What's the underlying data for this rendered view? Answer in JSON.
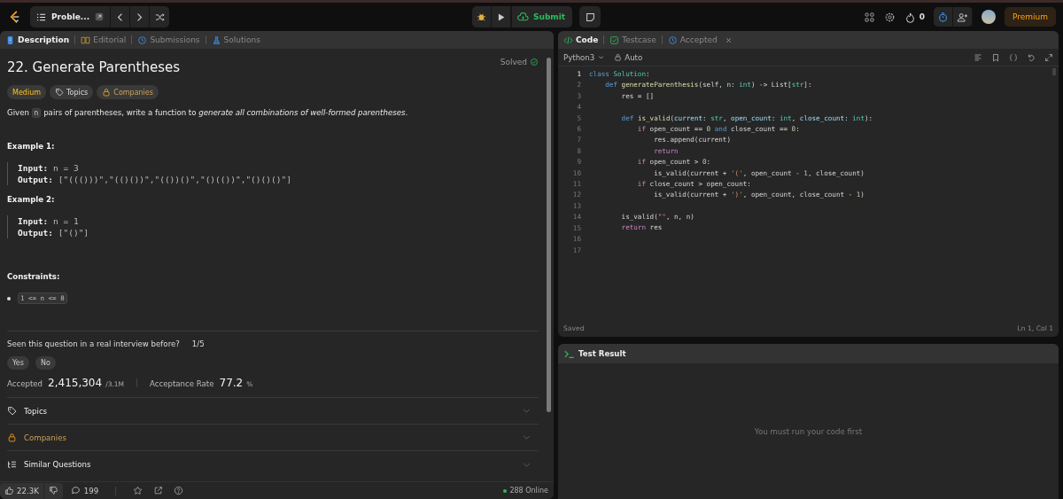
{
  "topbar": {
    "problem_list": "Proble...",
    "submit": "Submit",
    "streak": "0",
    "premium": "Premium"
  },
  "left_tabs": [
    {
      "label": "Description",
      "selected": true
    },
    {
      "label": "Editorial",
      "selected": false
    },
    {
      "label": "Submissions",
      "selected": false
    },
    {
      "label": "Solutions",
      "selected": false
    }
  ],
  "problem": {
    "title": "22. Generate Parentheses",
    "status": "Solved",
    "tags": [
      {
        "label": "Medium",
        "kind": "difficulty"
      },
      {
        "label": "Topics",
        "kind": "topics"
      },
      {
        "label": "Companies",
        "kind": "companies"
      }
    ],
    "description": [
      {
        "kind": "text",
        "text": "Given "
      },
      {
        "kind": "code",
        "text": "n"
      },
      {
        "kind": "text",
        "text": " pairs of parentheses, write a function to *generate all combinations of well-formed parentheses*."
      }
    ],
    "examples": [
      {
        "title": "Example 1:",
        "lines": [
          {
            "label": "Input:",
            "value": "n = 3"
          },
          {
            "label": "Output:",
            "value": "[\"((()))\",\"(()())\",\"(())()\",\"()(())\",\"()()()\"]"
          }
        ]
      },
      {
        "title": "Example 2:",
        "lines": [
          {
            "label": "Input:",
            "value": "n = 1"
          },
          {
            "label": "Output:",
            "value": "[\"()\"]"
          }
        ]
      }
    ],
    "constraints_title": "Constraints:",
    "constraints": [
      "1 <= n <= 8"
    ],
    "interview_question": "Seen this question in a real interview before?",
    "interview_count": "1/5",
    "answers": [
      "Yes",
      "No"
    ],
    "accepted_label": "Accepted",
    "accepted_value": "2,415,304",
    "accepted_total": "/3.1M",
    "rate_label": "Acceptance Rate",
    "rate_value": "77.2",
    "rate_unit": "%",
    "sections": [
      {
        "label": "Topics",
        "expanded": false
      },
      {
        "label": "Companies",
        "expanded": false
      },
      {
        "label": "Similar Questions",
        "expanded": false
      }
    ]
  },
  "bottom_bar": {
    "likes": "22.3K",
    "comments": "199",
    "online": "288 Online"
  },
  "right_tabs": [
    {
      "label": "Code",
      "selected": true,
      "closable": false
    },
    {
      "label": "Testcase",
      "selected": false,
      "closable": false
    },
    {
      "label": "Accepted",
      "selected": false,
      "closable": true
    }
  ],
  "editor": {
    "language": "Python3",
    "mode": "Auto",
    "status": "Saved",
    "cursor": "Ln 1, Col 1",
    "lines": [
      {
        "number": "1",
        "current": true,
        "code": [
          {
            "t": "class ",
            "kind": "kw"
          },
          {
            "t": "Solution",
            "kind": "type"
          },
          {
            "t": ":",
            "kind": "p"
          }
        ]
      },
      {
        "number": "2",
        "current": false,
        "code": [
          {
            "t": "    def ",
            "kind": "kw"
          },
          {
            "t": "generateParenthesis",
            "kind": "fn"
          },
          {
            "t": "(self, ",
            "kind": "p"
          },
          {
            "t": "n",
            "kind": "var"
          },
          {
            "t": ": ",
            "kind": "p"
          },
          {
            "t": "int",
            "kind": "type"
          },
          {
            "t": ") -> List[",
            "kind": "p"
          },
          {
            "t": "str",
            "kind": "type"
          },
          {
            "t": "]:",
            "kind": "p"
          }
        ]
      },
      {
        "number": "3",
        "current": false,
        "code": [
          {
            "t": "        res = []",
            "kind": "p"
          }
        ]
      },
      {
        "number": "4",
        "current": false
      },
      {
        "number": "5",
        "current": false,
        "code": [
          {
            "t": "        def ",
            "kind": "kw"
          },
          {
            "t": "is_valid",
            "kind": "fn"
          },
          {
            "t": "(",
            "kind": "p"
          },
          {
            "t": "current",
            "kind": "var"
          },
          {
            "t": ": ",
            "kind": "p"
          },
          {
            "t": "str",
            "kind": "type"
          },
          {
            "t": ", ",
            "kind": "p"
          },
          {
            "t": "open_count",
            "kind": "var"
          },
          {
            "t": ": ",
            "kind": "p"
          },
          {
            "t": "int",
            "kind": "type"
          },
          {
            "t": ", ",
            "kind": "p"
          },
          {
            "t": "close_count",
            "kind": "var"
          },
          {
            "t": ": ",
            "kind": "p"
          },
          {
            "t": "int",
            "kind": "type"
          },
          {
            "t": "):",
            "kind": "p"
          }
        ]
      },
      {
        "number": "6",
        "current": false,
        "code": [
          {
            "t": "            if ",
            "kind": "ctrl"
          },
          {
            "t": "open_count == ",
            "kind": "p"
          },
          {
            "t": "0",
            "kind": "num"
          },
          {
            "t": " and ",
            "kind": "kw"
          },
          {
            "t": "close_count == ",
            "kind": "p"
          },
          {
            "t": "0",
            "kind": "num"
          },
          {
            "t": ":",
            "kind": "p"
          }
        ]
      },
      {
        "number": "7",
        "current": false,
        "code": [
          {
            "t": "                res.append(current)",
            "kind": "p"
          }
        ]
      },
      {
        "number": "8",
        "current": false,
        "code": [
          {
            "t": "                return",
            "kind": "ctrl"
          }
        ]
      },
      {
        "number": "9",
        "current": false,
        "code": [
          {
            "t": "            if ",
            "kind": "ctrl"
          },
          {
            "t": "open_count > ",
            "kind": "p"
          },
          {
            "t": "0",
            "kind": "num"
          },
          {
            "t": ":",
            "kind": "p"
          }
        ]
      },
      {
        "number": "10",
        "current": false,
        "code": [
          {
            "t": "                is_valid(current + ",
            "kind": "p"
          },
          {
            "t": "'('",
            "kind": "str"
          },
          {
            "t": ", open_count - ",
            "kind": "p"
          },
          {
            "t": "1",
            "kind": "num"
          },
          {
            "t": ", close_count)",
            "kind": "p"
          }
        ]
      },
      {
        "number": "11",
        "current": false,
        "code": [
          {
            "t": "            if ",
            "kind": "ctrl"
          },
          {
            "t": "close_count > open_count:",
            "kind": "p"
          }
        ]
      },
      {
        "number": "12",
        "current": false,
        "code": [
          {
            "t": "                is_valid(current + ",
            "kind": "p"
          },
          {
            "t": "')'",
            "kind": "str"
          },
          {
            "t": ", open_count, close_count - ",
            "kind": "p"
          },
          {
            "t": "1",
            "kind": "num"
          },
          {
            "t": ")",
            "kind": "p"
          }
        ]
      },
      {
        "number": "13",
        "current": false
      },
      {
        "number": "14",
        "current": false,
        "code": [
          {
            "t": "        is_valid(",
            "kind": "p"
          },
          {
            "t": "\"\"",
            "kind": "str"
          },
          {
            "t": ", n, n)",
            "kind": "p"
          }
        ]
      },
      {
        "number": "15",
        "current": false,
        "code": [
          {
            "t": "        return ",
            "kind": "ctrl"
          },
          {
            "t": "res",
            "kind": "p"
          }
        ]
      },
      {
        "number": "16",
        "current": false
      },
      {
        "number": "17",
        "current": false
      }
    ]
  },
  "test_result": {
    "title": "Test Result",
    "message": "You must run your code first"
  }
}
